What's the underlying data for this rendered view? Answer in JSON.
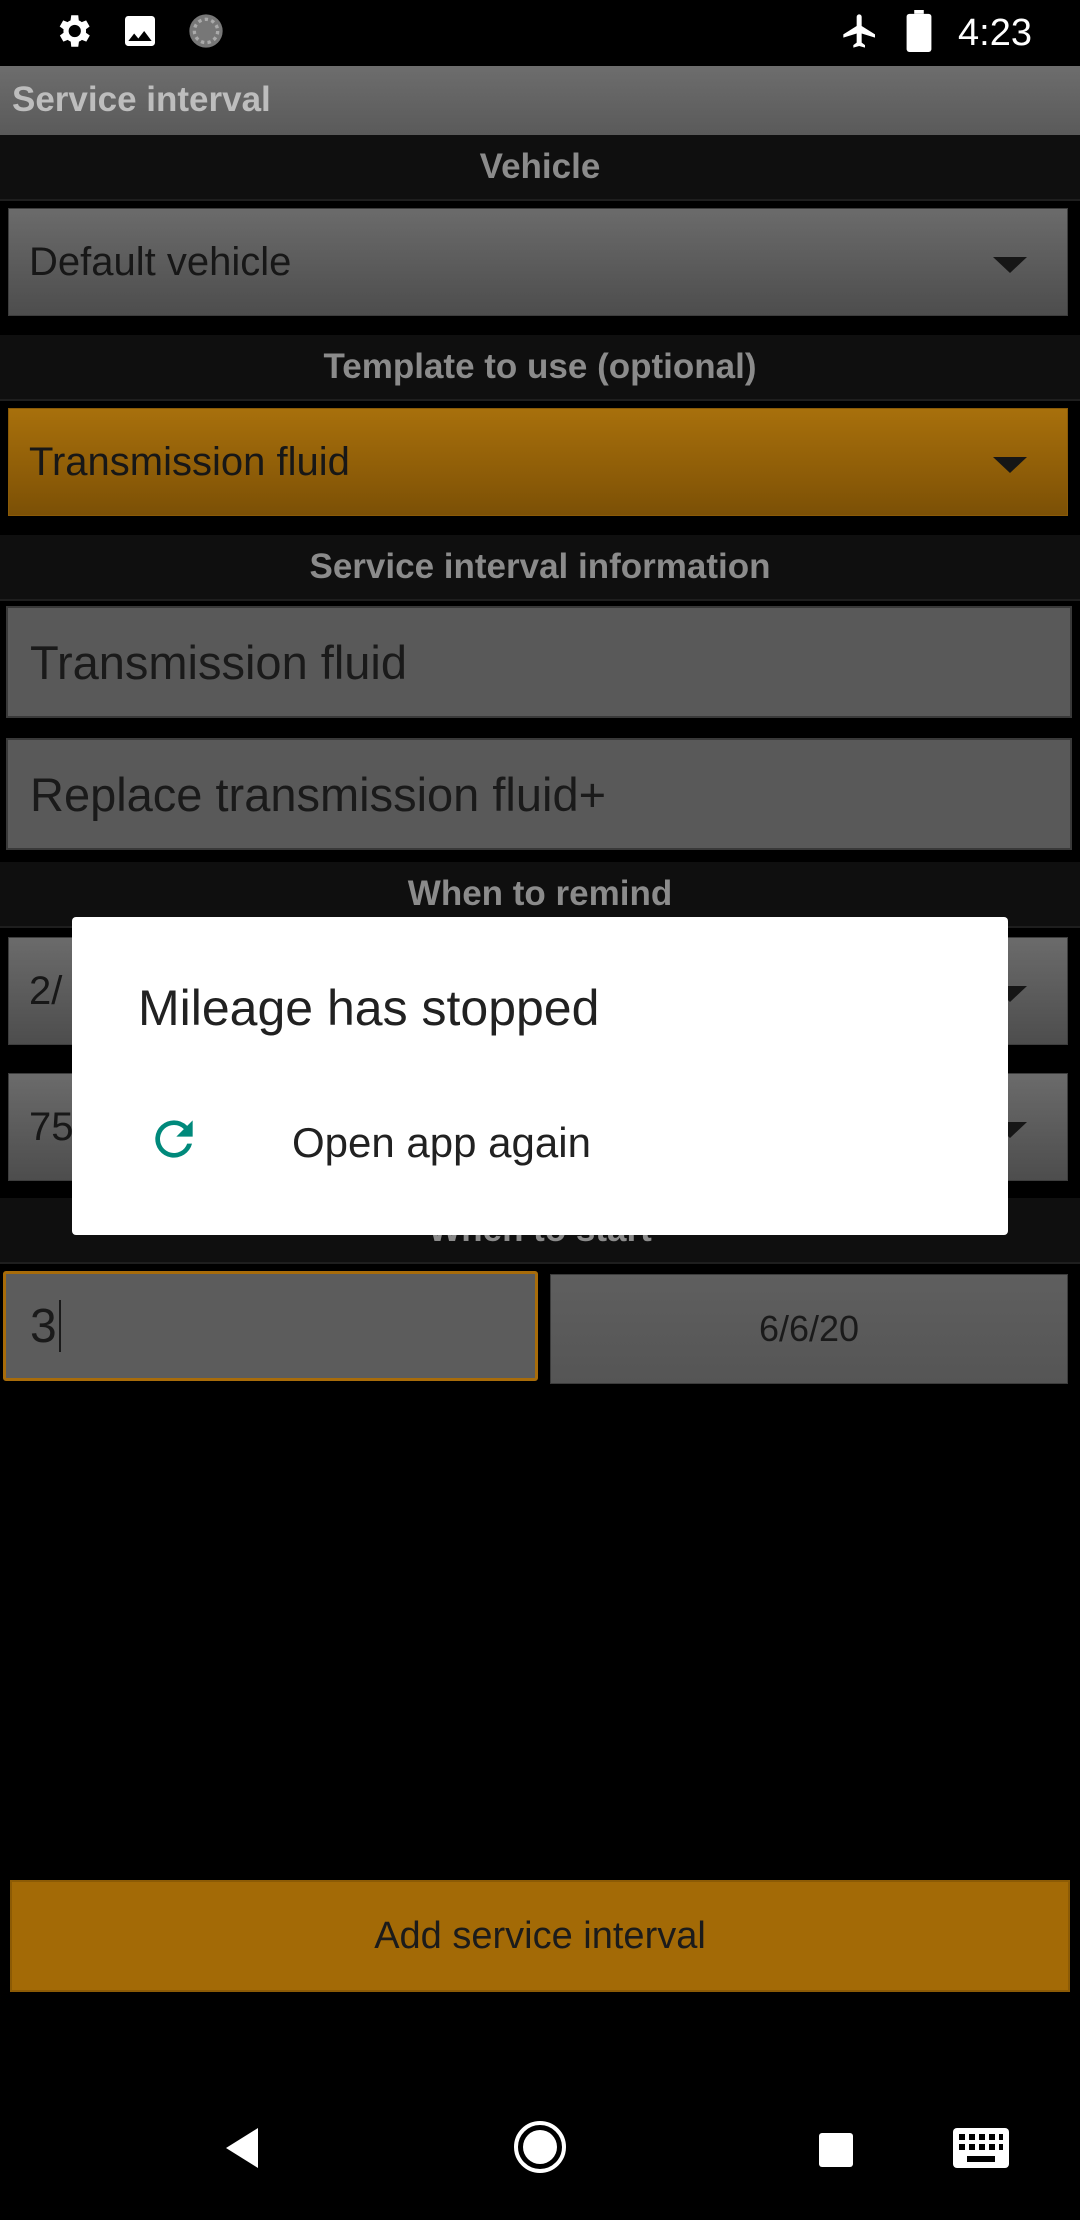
{
  "status_bar": {
    "time": "4:23",
    "left_icons": [
      "settings-icon",
      "image-icon",
      "loading-icon"
    ],
    "right_icons": [
      "airplane-icon",
      "battery-icon"
    ]
  },
  "app": {
    "title": "Service interval",
    "accent_color": "#a36a06"
  },
  "form": {
    "vehicle_header": "Vehicle",
    "vehicle_value": "Default vehicle",
    "template_header": "Template to use (optional)",
    "template_value": "Transmission fluid",
    "info_header": "Service interval information",
    "name_value": "Transmission fluid",
    "description_value": "Replace transmission fluid+",
    "remind_header": "When to remind",
    "remind_time_value_partial": "2/",
    "remind_distance_value_partial": "75",
    "start_header": "When to start",
    "start_value": "3",
    "start_date": "6/6/20",
    "add_button": "Add service interval"
  },
  "dialog": {
    "title": "Mileage has stopped",
    "action_label": "Open app again",
    "action_icon": "refresh-icon",
    "icon_color": "#00897b"
  },
  "nav": {
    "icons": [
      "back-icon",
      "home-icon",
      "recents-icon",
      "keyboard-icon"
    ]
  }
}
